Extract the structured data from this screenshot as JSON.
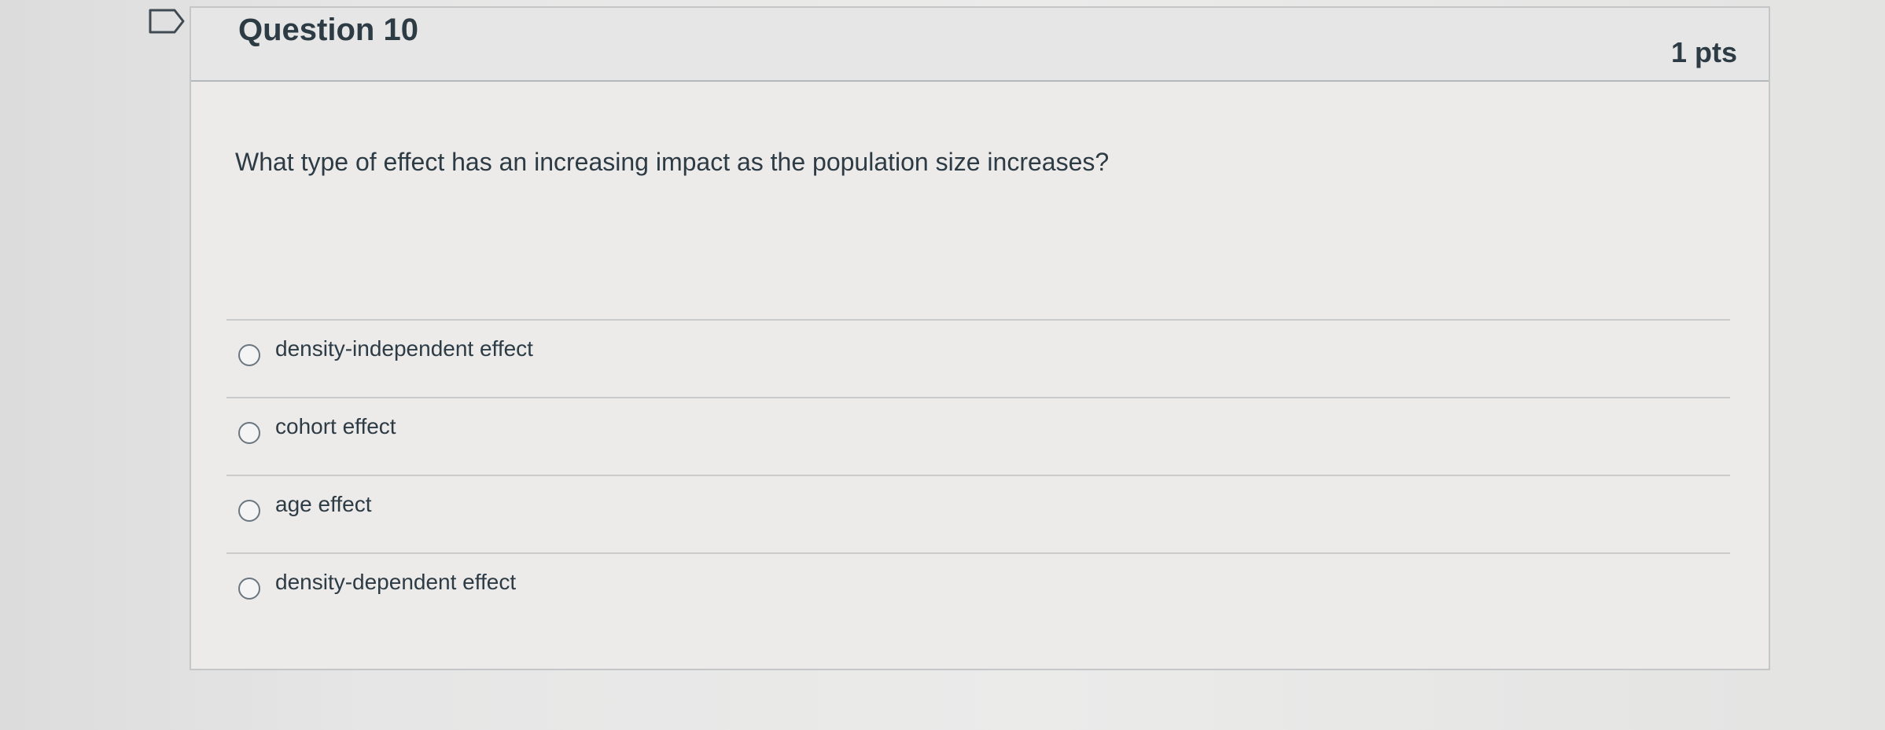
{
  "question": {
    "title": "Question 10",
    "points": "1 pts",
    "text": "What type of effect has an increasing impact as the population size increases?"
  },
  "answers": [
    {
      "label": "density-independent effect"
    },
    {
      "label": "cohort effect"
    },
    {
      "label": "age effect"
    },
    {
      "label": "density-dependent effect"
    }
  ],
  "colors": {
    "text": "#2d3b45",
    "border": "#c4c6c8",
    "header_bg": "#e6e6e6"
  },
  "icons": {
    "flag": "flag-outline-icon"
  }
}
